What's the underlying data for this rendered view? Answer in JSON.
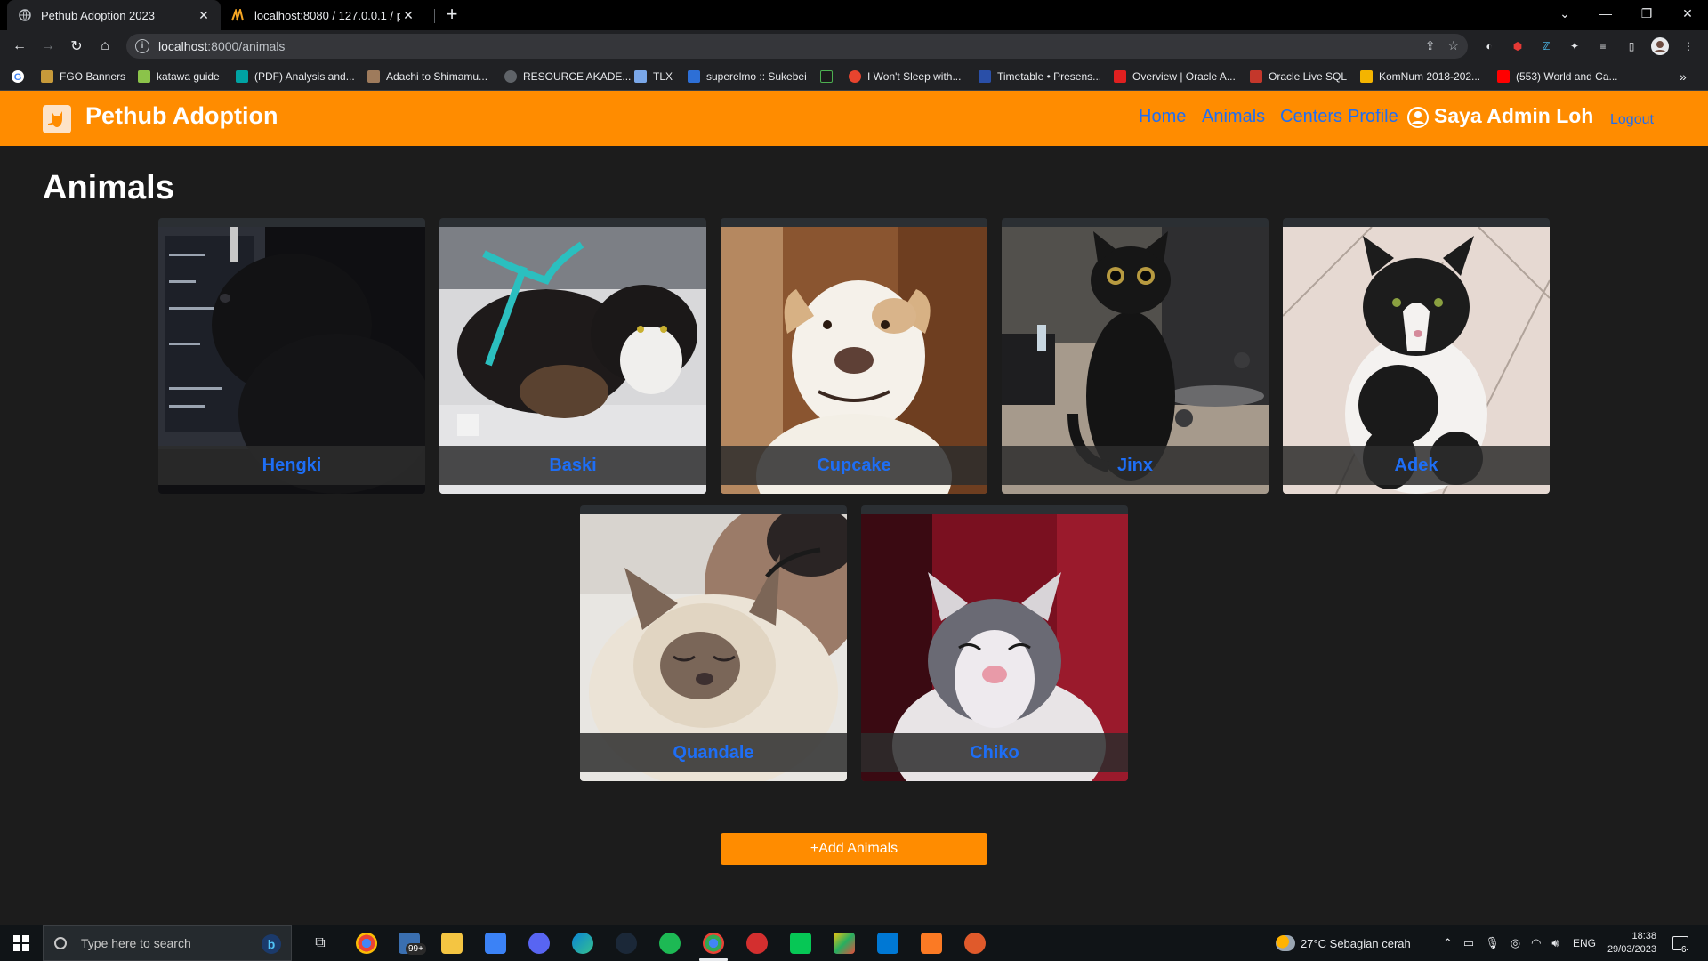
{
  "browser": {
    "tabs": [
      {
        "title": "Pethub Adoption 2023",
        "active": true
      },
      {
        "title": "localhost:8080 / 127.0.0.1 / pethub",
        "active": false
      }
    ],
    "address": {
      "host": "localhost",
      "path": ":8000/animals"
    },
    "bookmarks": [
      {
        "label": "FGO Banners",
        "color": "#c79a3a"
      },
      {
        "label": "katawa guide",
        "color": "#8bc34a"
      },
      {
        "label": "(PDF) Analysis and...",
        "color": "#00a3a3"
      },
      {
        "label": "Adachi to Shimamu...",
        "color": "#9e7b5c"
      },
      {
        "label": "RESOURCE AKADE...",
        "color": "#5f6368"
      },
      {
        "label": "TLX",
        "color": "#7aa7e8"
      },
      {
        "label": "superelmo :: Sukebei",
        "color": "#2d6fd6"
      },
      {
        "label": "I Won't Sleep with...",
        "color": "#e8442e"
      },
      {
        "label": "Timetable • Presens...",
        "color": "#2a4fa8"
      },
      {
        "label": "Overview | Oracle A...",
        "color": "#e02020"
      },
      {
        "label": "Oracle Live SQL",
        "color": "#c4372b"
      },
      {
        "label": "KomNum 2018-202...",
        "color": "#f4b400"
      },
      {
        "label": "(553) World and Ca...",
        "color": "#ff0000"
      }
    ]
  },
  "app": {
    "brand": "Pethub Adoption",
    "nav": {
      "home": "Home",
      "animals": "Animals",
      "centers": "Centers",
      "profile": "Profile"
    },
    "user": "Saya Admin Loh",
    "logout": "Logout",
    "page_title": "Animals",
    "animals": [
      {
        "name": "Hengki"
      },
      {
        "name": "Baski"
      },
      {
        "name": "Cupcake"
      },
      {
        "name": "Jinx"
      },
      {
        "name": "Adek"
      },
      {
        "name": "Quandale"
      },
      {
        "name": "Chiko"
      }
    ],
    "add_button": "+Add Animals"
  },
  "taskbar": {
    "search_placeholder": "Type here to search",
    "weather": "27°C  Sebagian cerah",
    "language": "ENG",
    "time": "18:38",
    "date": "29/03/2023",
    "mail_badge": "99+",
    "notif_count": "6"
  }
}
